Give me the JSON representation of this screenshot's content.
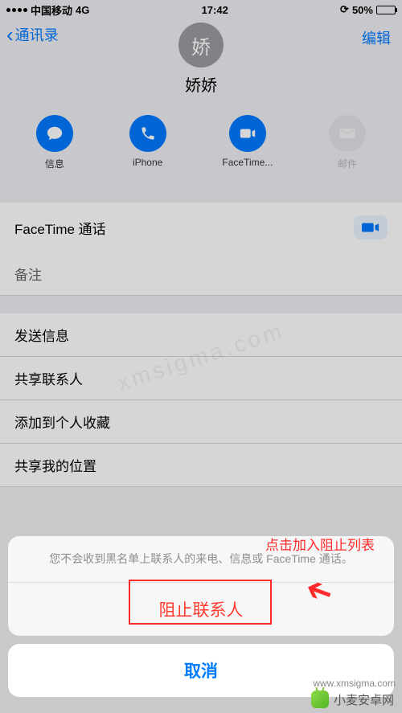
{
  "status": {
    "carrier": "中国移动",
    "network": "4G",
    "time": "17:42",
    "battery_pct": "50%"
  },
  "header": {
    "back": "通讯录",
    "edit": "编辑",
    "avatar_initial": "娇",
    "name": "娇娇"
  },
  "actions": {
    "message": "信息",
    "call": "iPhone",
    "facetime": "FaceTime...",
    "mail": "邮件"
  },
  "rows": {
    "facetime": "FaceTime 通话",
    "notes": "备注",
    "send_message": "发送信息",
    "share_contact": "共享联系人",
    "add_favorite": "添加到个人收藏",
    "share_location": "共享我的位置"
  },
  "sheet": {
    "message": "您不会收到黑名单上联系人的来电、信息或 FaceTime 通话。",
    "block": "阻止联系人",
    "cancel": "取消"
  },
  "annotation": {
    "label": "点击加入阻止列表"
  },
  "watermark": {
    "center": "xmsigma.com",
    "brand": "小麦安卓网",
    "url": "www.xmsigma.com"
  }
}
